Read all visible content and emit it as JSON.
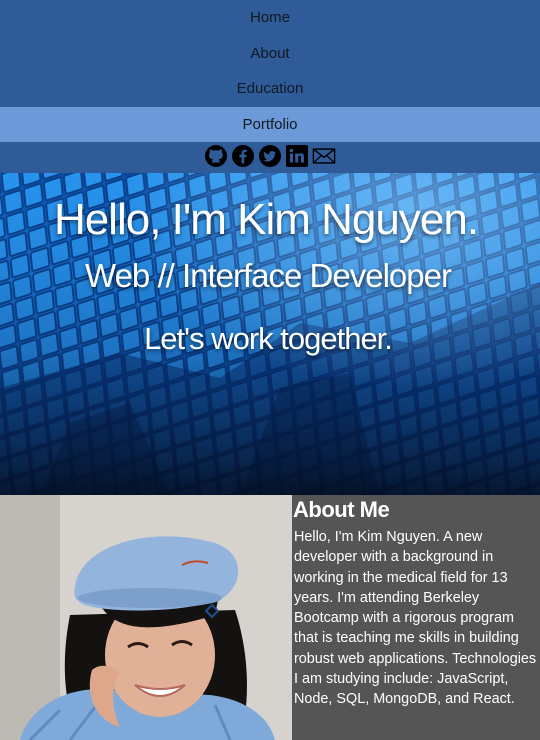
{
  "nav": {
    "items": [
      {
        "label": "Home"
      },
      {
        "label": "About"
      },
      {
        "label": "Education"
      },
      {
        "label": "Portfolio"
      }
    ],
    "active_index": 3,
    "socials": [
      {
        "name": "github-icon"
      },
      {
        "name": "facebook-icon"
      },
      {
        "name": "twitter-icon"
      },
      {
        "name": "linkedin-icon"
      },
      {
        "name": "email-icon"
      }
    ]
  },
  "hero": {
    "greeting": "Hello, I'm Kim Nguyen.",
    "role": "Web // Interface Developer",
    "cta": "Let's work together."
  },
  "about": {
    "title": "About Me",
    "body": "Hello, I'm Kim Nguyen. A new developer with a background in working in the medical field for 13 years. I'm attending Berkeley Bootcamp with a rigorous program that is teaching me skills in building robust web applications. Technologies I am studying include: JavaScript, Node, SQL, MongoDB, and React."
  },
  "colors": {
    "nav_bg": "#2f5c99",
    "nav_active": "#6c9ad8",
    "about_bg": "#555555"
  }
}
